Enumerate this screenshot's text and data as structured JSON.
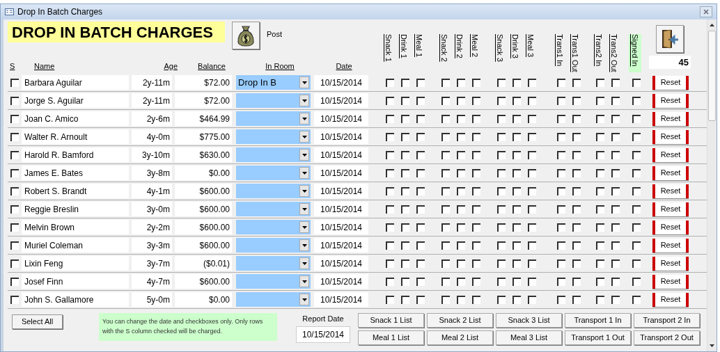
{
  "window": {
    "title": "Drop In Batch Charges"
  },
  "heading": "DROP IN BATCH CHARGES",
  "post_label": "Post",
  "columns": {
    "s": "S",
    "name": "Name",
    "age": "Age",
    "balance": "Balance",
    "room": "In Room",
    "date": "Date"
  },
  "check_columns": [
    {
      "label": "Snack 1",
      "highlight": false
    },
    {
      "label": "Drink 1",
      "highlight": false
    },
    {
      "label": "Meal 1",
      "highlight": false
    },
    {
      "label": "Snack 2",
      "highlight": false
    },
    {
      "label": "Drink 2",
      "highlight": false
    },
    {
      "label": "Meal 2",
      "highlight": false
    },
    {
      "label": "Snack 3",
      "highlight": false
    },
    {
      "label": "Drink 3",
      "highlight": false
    },
    {
      "label": "Meal 3",
      "highlight": false
    },
    {
      "label": "Trans1 In",
      "highlight": false
    },
    {
      "label": "Trans1 Out",
      "highlight": false
    },
    {
      "label": "Trans2 In",
      "highlight": false
    },
    {
      "label": "Trans2 Out",
      "highlight": false
    },
    {
      "label": "Signed In",
      "highlight": true
    }
  ],
  "count": "45",
  "rows": [
    {
      "selected": false,
      "name": "Barbara Aguilar",
      "age": "2y-11m",
      "balance": "$72.00",
      "room": "Drop In B",
      "date": "10/15/2014",
      "checks": [
        false,
        false,
        false,
        false,
        false,
        false,
        false,
        false,
        false,
        false,
        false,
        false,
        false,
        false
      ],
      "reset": "Reset"
    },
    {
      "selected": false,
      "name": "Jorge S. Aguilar",
      "age": "2y-11m",
      "balance": "$72.00",
      "date": "10/15/2014",
      "checks": [
        false,
        false,
        false,
        false,
        false,
        false,
        false,
        false,
        false,
        false,
        false,
        false,
        false,
        false
      ],
      "reset": "Reset"
    },
    {
      "selected": false,
      "name": "Joan C. Amico",
      "age": "2y-6m",
      "balance": "$464.99",
      "date": "10/15/2014",
      "checks": [
        false,
        false,
        false,
        false,
        false,
        false,
        false,
        false,
        false,
        false,
        false,
        false,
        false,
        false
      ],
      "reset": "Reset"
    },
    {
      "selected": false,
      "name": "Walter R. Arnoult",
      "age": "4y-0m",
      "balance": "$775.00",
      "date": "10/15/2014",
      "checks": [
        false,
        false,
        false,
        false,
        false,
        false,
        false,
        false,
        false,
        false,
        false,
        false,
        false,
        false
      ],
      "reset": "Reset"
    },
    {
      "selected": false,
      "name": "Harold R. Bamford",
      "age": "3y-10m",
      "balance": "$630.00",
      "date": "10/15/2014",
      "checks": [
        false,
        false,
        false,
        false,
        false,
        false,
        false,
        false,
        false,
        false,
        false,
        false,
        false,
        false
      ],
      "reset": "Reset"
    },
    {
      "selected": false,
      "name": "James E. Bates",
      "age": "3y-8m",
      "balance": "$0.00",
      "date": "10/15/2014",
      "checks": [
        false,
        false,
        false,
        false,
        false,
        false,
        false,
        false,
        false,
        false,
        false,
        false,
        false,
        false
      ],
      "reset": "Reset"
    },
    {
      "selected": false,
      "name": "Robert S. Brandt",
      "age": "4y-1m",
      "balance": "$600.00",
      "date": "10/15/2014",
      "checks": [
        false,
        false,
        false,
        false,
        false,
        false,
        false,
        false,
        false,
        false,
        false,
        false,
        false,
        false
      ],
      "reset": "Reset"
    },
    {
      "selected": false,
      "name": "Reggie Breslin",
      "age": "3y-0m",
      "balance": "$600.00",
      "date": "10/15/2014",
      "checks": [
        false,
        false,
        false,
        false,
        false,
        false,
        false,
        false,
        false,
        false,
        false,
        false,
        false,
        false
      ],
      "reset": "Reset"
    },
    {
      "selected": false,
      "name": "Melvin Brown",
      "age": "2y-2m",
      "balance": "$600.00",
      "date": "10/15/2014",
      "checks": [
        false,
        false,
        false,
        false,
        false,
        false,
        false,
        false,
        false,
        false,
        false,
        false,
        false,
        false
      ],
      "reset": "Reset"
    },
    {
      "selected": false,
      "name": "Muriel Coleman",
      "age": "3y-3m",
      "balance": "$600.00",
      "date": "10/15/2014",
      "checks": [
        false,
        false,
        false,
        false,
        false,
        false,
        false,
        false,
        false,
        false,
        false,
        false,
        false,
        false
      ],
      "reset": "Reset"
    },
    {
      "selected": false,
      "name": "Lixin Feng",
      "age": "3y-7m",
      "balance": "($0.01)",
      "date": "10/15/2014",
      "checks": [
        false,
        false,
        false,
        false,
        false,
        false,
        false,
        false,
        false,
        false,
        false,
        false,
        false,
        false
      ],
      "reset": "Reset"
    },
    {
      "selected": false,
      "name": "Josef Finn",
      "age": "4y-7m",
      "balance": "$600.00",
      "date": "10/15/2014",
      "checks": [
        false,
        false,
        false,
        false,
        false,
        false,
        false,
        false,
        false,
        false,
        false,
        false,
        false,
        false
      ],
      "reset": "Reset"
    },
    {
      "selected": false,
      "name": "John S. Gallamore",
      "age": "5y-0m",
      "balance": "$0.00",
      "date": "10/15/2014",
      "checks": [
        false,
        false,
        false,
        false,
        false,
        false,
        false,
        false,
        false,
        false,
        false,
        false,
        false,
        false
      ],
      "reset": "Reset"
    }
  ],
  "select_all": "Select All",
  "note": "You can change the date and checkboxes only. Only rows with the S column checked will be charged.",
  "report_date": {
    "label": "Report Date",
    "value": "10/15/2014"
  },
  "list_buttons": [
    "Snack 1 List",
    "Snack 2 List",
    "Snack 3 List",
    "Transport 1 In",
    "Transport 2 In",
    "Meal 1 List",
    "Meal 2 List",
    "Meal 3 List",
    "Transport 1 Out",
    "Transport 2 Out"
  ]
}
